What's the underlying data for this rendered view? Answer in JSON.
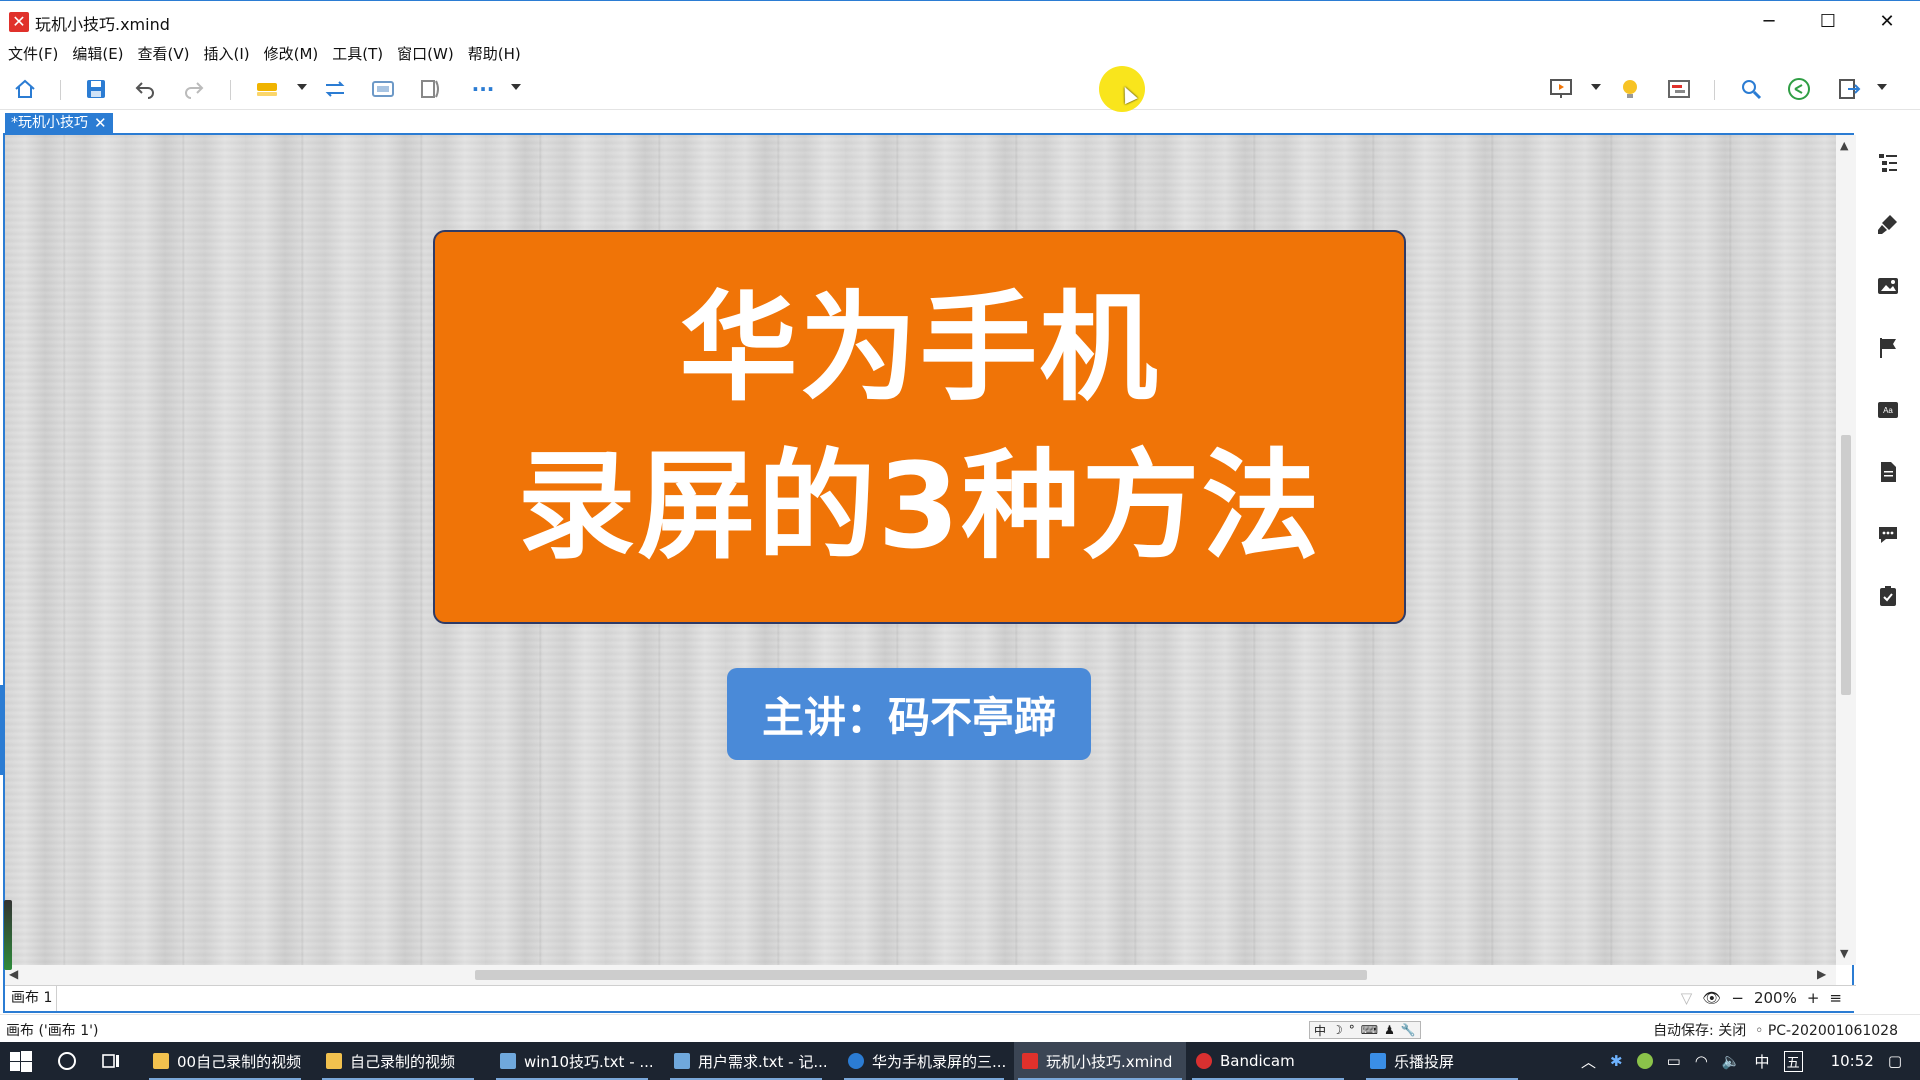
{
  "window": {
    "title": "玩机小技巧.xmind",
    "logo_glyph": "✕",
    "minimize": "─",
    "maximize": "☐",
    "close": "✕"
  },
  "menu": [
    "文件(F)",
    "编辑(E)",
    "查看(V)",
    "插入(I)",
    "修改(M)",
    "工具(T)",
    "窗口(W)",
    "帮助(H)"
  ],
  "toolbar": {
    "icons": [
      "home-icon",
      "save-icon",
      "undo-icon",
      "redo-icon",
      "topic-icon",
      "relationship-icon",
      "boundary-icon",
      "summary-icon",
      "more-icon",
      "presentation-icon",
      "idea-icon",
      "gantt-icon",
      "search-icon",
      "share-icon",
      "export-icon"
    ],
    "more_glyph": "···"
  },
  "tab": {
    "label": "*玩机小技巧",
    "close": "✕"
  },
  "canvas": {
    "main_topic_lines": [
      "华为手机",
      "录屏的3种方法"
    ],
    "sub_topic": "主讲：码不亭蹄",
    "main_color": "#f07407",
    "sub_color": "#4a8ad8"
  },
  "sheet": {
    "name": "画布 1",
    "zoom": "200%",
    "zoom_out": "−",
    "zoom_in": "+",
    "fit": "≡"
  },
  "side_panel": [
    "outline-icon",
    "format-icon",
    "image-icon",
    "marker-icon",
    "style-icon",
    "notes-icon",
    "comments-icon",
    "task-icon"
  ],
  "status": {
    "left": "画布 ('画布 1')",
    "ime": [
      "中",
      "☽",
      "°",
      "⌨",
      "♟",
      "🔧"
    ],
    "autosave": "自动保存: 关闭",
    "computer": "PC-202001061028"
  },
  "taskbar": {
    "tasks": [
      {
        "label": "00自己录制的视频",
        "icon_color": "#f2c14e"
      },
      {
        "label": "自己录制的视频",
        "icon_color": "#f2c14e"
      },
      {
        "label": "win10技巧.txt - ...",
        "icon_color": "#6fa8dc"
      },
      {
        "label": "用户需求.txt - 记...",
        "icon_color": "#6fa8dc"
      },
      {
        "label": "华为手机录屏的三...",
        "icon_color": "#2b7cd3"
      },
      {
        "label": "玩机小技巧.xmind",
        "icon_color": "#e0312b"
      },
      {
        "label": "Bandicam",
        "icon_color": "#d93030"
      },
      {
        "label": "乐播投屏",
        "icon_color": "#3a8ee6"
      }
    ],
    "tray_ime": "中",
    "tray_ime2": "五",
    "clock": "10:52"
  }
}
